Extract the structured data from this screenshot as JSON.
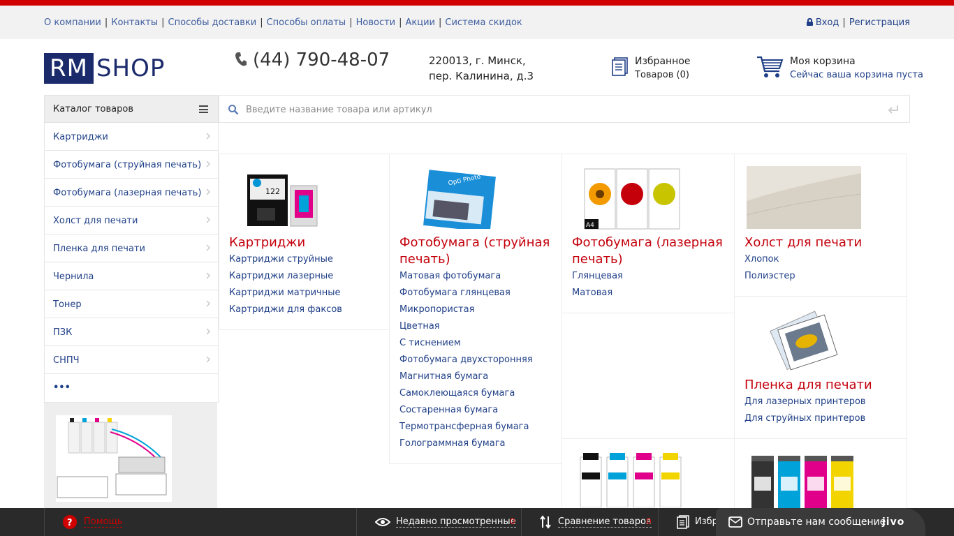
{
  "top_nav": {
    "links": [
      "О компании",
      "Контакты",
      "Способы доставки",
      "Способы оплаты",
      "Новости",
      "Акции",
      "Система скидок"
    ],
    "login": "Вход",
    "register": "Регистрация"
  },
  "header": {
    "logo_rm": "RM",
    "logo_shop": "SHOP",
    "phone": "(44) 790-48-07",
    "address_line1": "220013, г. Минск,",
    "address_line2": "пер. Калинина, д.3",
    "favorites_title": "Избранное",
    "favorites_count": "Товаров (0)",
    "cart_title": "Моя корзина",
    "cart_status": "Сейчас ваша корзина пуста"
  },
  "catalog": {
    "title": "Каталог товаров",
    "items": [
      "Картриджи",
      "Фотобумага (струйная печать)",
      "Фотобумага (лазерная печать)",
      "Холст для печати",
      "Пленка для печати",
      "Чернила",
      "Тонер",
      "ПЗК",
      "СНПЧ"
    ],
    "more": "•••"
  },
  "search": {
    "placeholder": "Введите название товара или артикул"
  },
  "categories": [
    {
      "title": "Картриджи",
      "subs": [
        "Картриджи струйные",
        "Картриджи лазерные",
        "Картриджи матричные",
        "Картриджи для факсов"
      ]
    },
    {
      "title": "Фотобумага (струйная печать)",
      "subs": [
        "Матовая фотобумага",
        "Фотобумага глянцевая",
        "Микропористая",
        "Цветная",
        "С тиснением",
        "Фотобумага двухсторонняя",
        "Магнитная бумага",
        "Самоклеющаяся бумага",
        "Состаренная бумага",
        "Термотрансферная бумага",
        "Голограммная бумага"
      ]
    },
    {
      "title": "Фотобумага (лазерная печать)",
      "subs": [
        "Глянцевая",
        "Матовая"
      ]
    },
    {
      "title": "Холст для печати",
      "subs": [
        "Хлопок",
        "Полиэстер"
      ]
    },
    {
      "title": "Пленка для печати",
      "subs": [
        "Для лазерных принтеров",
        "Для струйных принтеров"
      ]
    }
  ],
  "bottom_bar": {
    "help": "Помощь",
    "recent": "Недавно просмотренные",
    "recent_count": "0",
    "compare": "Сравнение товаров",
    "compare_count": "0",
    "favorites": "Избр",
    "chat": "Отправьте нам сообщение",
    "chat_brand": "jivo"
  },
  "colors": {
    "brand_red": "#c4000b",
    "link_blue": "#1f3f87",
    "logo_navy": "#1b2a6b"
  }
}
